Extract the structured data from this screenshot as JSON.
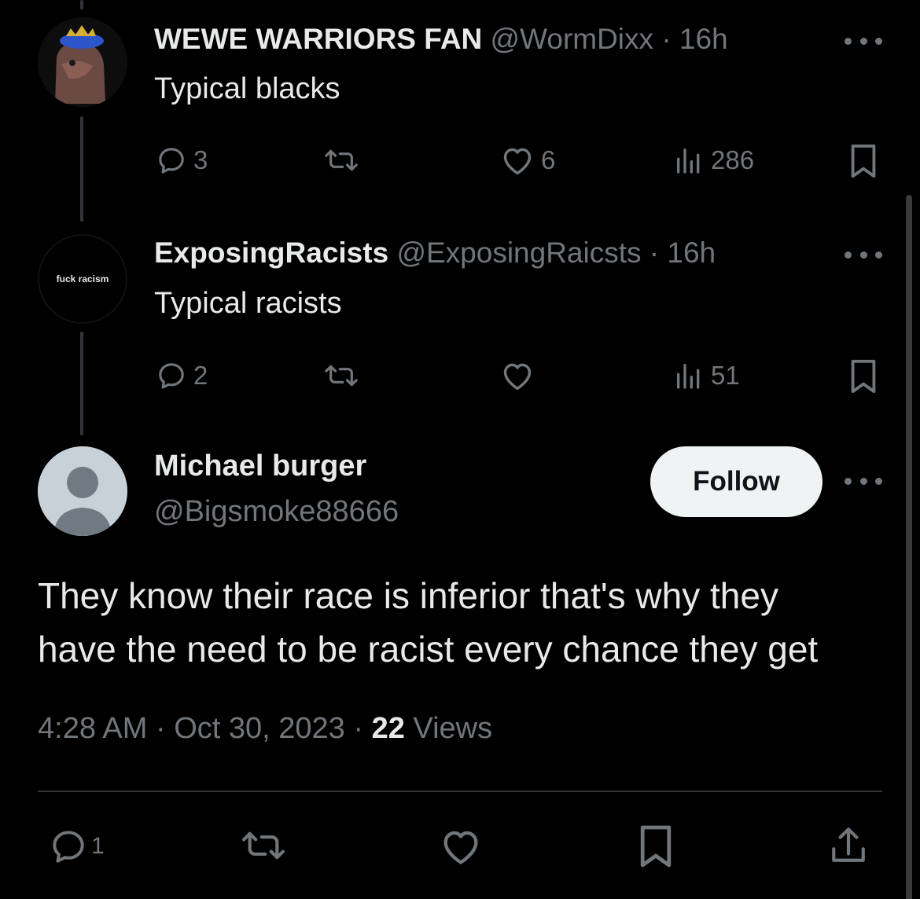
{
  "replies": [
    {
      "name": "WEWE WARRIORS FAN",
      "handle": "@WormDixx",
      "time": "16h",
      "text": "Typical blacks",
      "reply_count": "3",
      "retweet_count": "",
      "like_count": "6",
      "view_count": "286"
    },
    {
      "name": "ExposingRacists",
      "handle": "@ExposingRaicsts",
      "time": "16h",
      "text": "Typical racists",
      "avatar_text": "fuck racism",
      "reply_count": "2",
      "retweet_count": "",
      "like_count": "",
      "view_count": "51"
    }
  ],
  "main_tweet": {
    "name": "Michael burger",
    "handle": "@Bigsmoke88666",
    "follow_label": "Follow",
    "text_lines": [
      "They know their race is inferior that's why they",
      "have the need to be racist every chance they get"
    ],
    "time": "4:28 AM",
    "date": "Oct 30, 2023",
    "views_count": "22",
    "views_label": "Views",
    "reply_count": "1"
  },
  "separator": "·",
  "icons": {
    "reply": "reply-icon",
    "retweet": "retweet-icon",
    "like": "heart-icon",
    "views": "views-icon",
    "bookmark": "bookmark-icon",
    "share": "share-icon",
    "more": "more-icon"
  },
  "colors": {
    "background": "#000000",
    "text": "#e7e9ea",
    "muted": "#71767b",
    "follow_bg": "#eff3f4"
  }
}
